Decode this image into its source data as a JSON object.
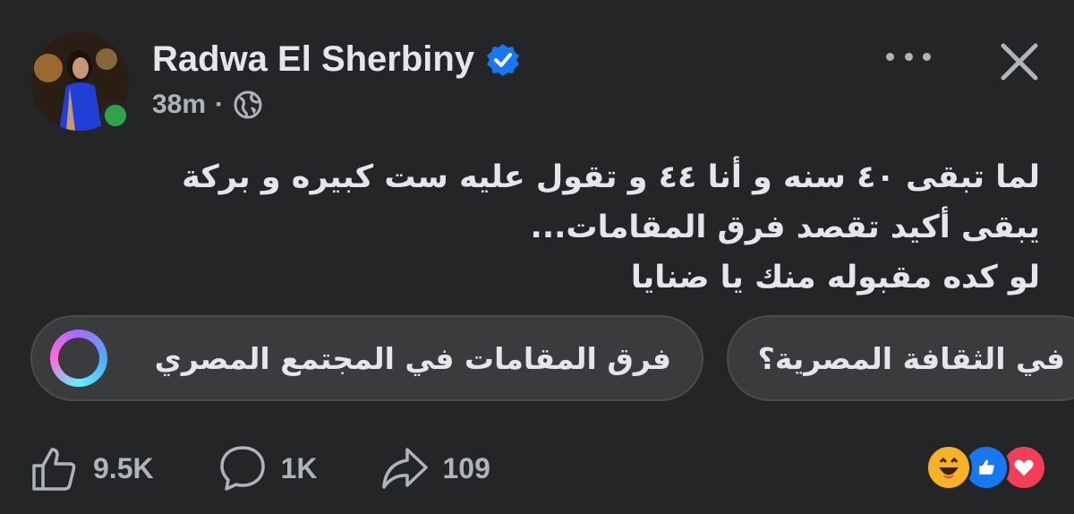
{
  "post": {
    "author": "Radwa El Sherbiny",
    "time": "38m",
    "separator": "·",
    "lines": [
      "لما تبقى ٤٠ سنه و أنا ٤٤ و تقول عليه ست كبيره و بركة",
      "يبقى أكيد تقصد فرق المقامات...",
      "لو كده مقبوله منك يا ضنايا"
    ]
  },
  "chips": [
    {
      "label": "فرق المقامات في المجتمع المصري"
    },
    {
      "label": "في الثقافة المصرية؟"
    }
  ],
  "actions": {
    "likes": "9.5K",
    "comments": "1K",
    "shares": "109"
  },
  "icons": {
    "verified": "verified-badge-icon",
    "audience": "globe-icon",
    "more": "more-options-icon",
    "close": "close-icon",
    "like": "thumbs-up-icon",
    "comment": "comment-bubble-icon",
    "share": "share-arrow-icon",
    "ai": "meta-ai-ring-icon"
  },
  "colors": {
    "background": "#242526",
    "chip": "#3a3b3c",
    "verified": "#1877f2",
    "online": "#31a24c",
    "love": "#f33e58"
  }
}
